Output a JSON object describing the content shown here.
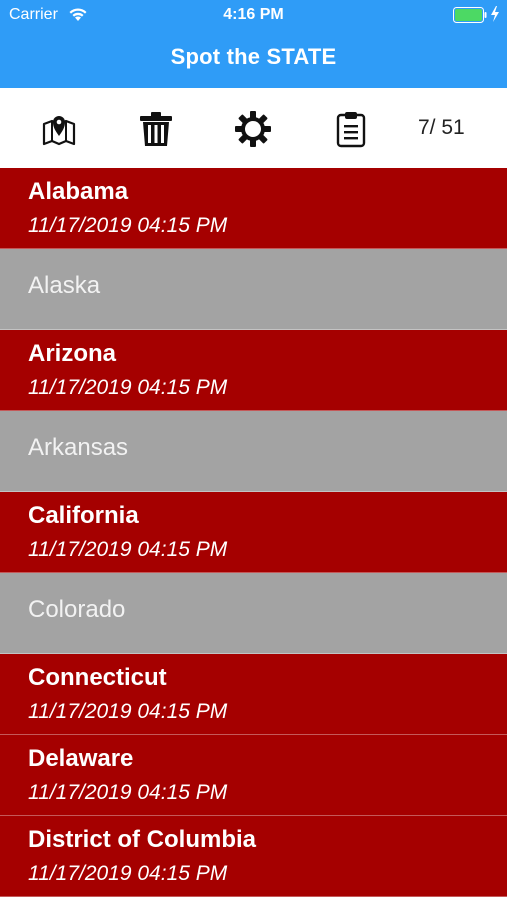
{
  "status_bar": {
    "carrier": "Carrier",
    "time": "4:16 PM"
  },
  "header": {
    "title": "Spot the STATE"
  },
  "toolbar": {
    "icons": [
      "map-pin-icon",
      "trash-icon",
      "gear-icon",
      "clipboard-icon"
    ],
    "counter": "7/ 51"
  },
  "colors": {
    "header": "#2f9cf7",
    "spotted": "#a50000",
    "unspotted": "#a3a3a3",
    "battery": "#4cd964"
  },
  "states": [
    {
      "name": "Alabama",
      "date": "11/17/2019 04:15 PM",
      "spotted": true
    },
    {
      "name": "Alaska",
      "date": "",
      "spotted": false
    },
    {
      "name": "Arizona",
      "date": "11/17/2019 04:15 PM",
      "spotted": true
    },
    {
      "name": "Arkansas",
      "date": "",
      "spotted": false
    },
    {
      "name": "California",
      "date": "11/17/2019 04:15 PM",
      "spotted": true
    },
    {
      "name": "Colorado",
      "date": "",
      "spotted": false
    },
    {
      "name": "Connecticut",
      "date": "11/17/2019 04:15 PM",
      "spotted": true
    },
    {
      "name": "Delaware",
      "date": "11/17/2019 04:15 PM",
      "spotted": true
    },
    {
      "name": "District of Columbia",
      "date": "11/17/2019 04:15 PM",
      "spotted": true
    }
  ]
}
